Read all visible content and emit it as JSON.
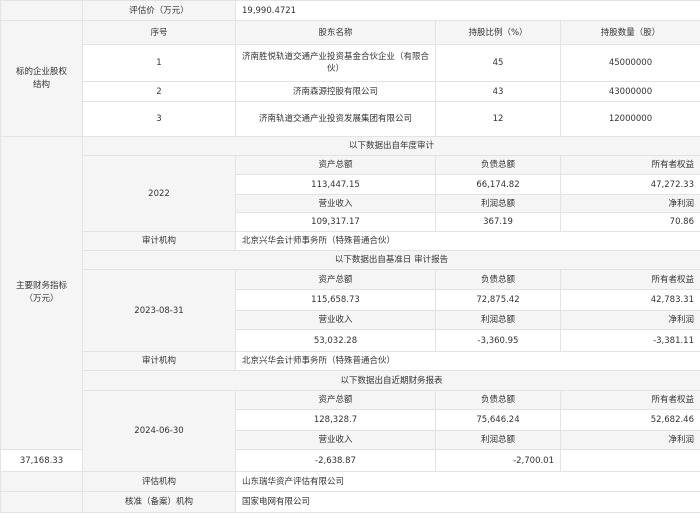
{
  "valuation": {
    "label": "评估价（万元）",
    "value": "19,990.4721"
  },
  "equity": {
    "section_label": "标的企业股权结构",
    "headers": [
      "序号",
      "股东名称",
      "持股比例（%）",
      "持股数量（股）"
    ],
    "rows": [
      {
        "no": "1",
        "name": "济南胜悦轨道交通产业投资基金合伙企业（有限合伙）",
        "ratio": "45",
        "shares": "45000000"
      },
      {
        "no": "2",
        "name": "济南森源控股有限公司",
        "ratio": "43",
        "shares": "43000000"
      },
      {
        "no": "3",
        "name": "济南轨道交通产业投资发展集团有限公司",
        "ratio": "12",
        "shares": "12000000"
      }
    ]
  },
  "financial": {
    "section_label": "主要财务指标（万元）",
    "periods": [
      {
        "source_note": "以下数据出自年度审计",
        "period": "2022",
        "h1": [
          "资产总额",
          "负债总额",
          "所有者权益"
        ],
        "v1": [
          "113,447.15",
          "66,174.82",
          "47,272.33"
        ],
        "h2": [
          "营业收入",
          "利润总额",
          "净利润"
        ],
        "v2": [
          "109,317.17",
          "367.19",
          "70.86"
        ],
        "auditor_label": "审计机构",
        "auditor": "北京兴华会计师事务所（特殊普通合伙）"
      },
      {
        "source_note": "以下数据出自基准日 审计报告",
        "period": "2023-08-31",
        "h1": [
          "资产总额",
          "负债总额",
          "所有者权益"
        ],
        "v1": [
          "115,658.73",
          "72,875.42",
          "42,783.31"
        ],
        "h2": [
          "营业收入",
          "利润总额",
          "净利润"
        ],
        "v2": [
          "53,032.28",
          "-3,360.95",
          "-3,381.11"
        ],
        "auditor_label": "审计机构",
        "auditor": "北京兴华会计师事务所（特殊普通合伙）"
      },
      {
        "source_note": "以下数据出自近期财务报表",
        "period": "2024-06-30",
        "h1": [
          "资产总额",
          "负债总额",
          "所有者权益"
        ],
        "v1": [
          "128,328.7",
          "75,646.24",
          "52,682.46"
        ],
        "h2": [
          "营业收入",
          "利润总额",
          "净利润"
        ],
        "v2": [
          "37,168.33",
          "-2,638.87",
          "-2,700.01"
        ]
      }
    ]
  },
  "appraiser": {
    "label": "评估机构",
    "value": "山东瑞华资产评估有限公司"
  },
  "approver": {
    "label": "核准（备案）机构",
    "value": "国家电网有限公司"
  }
}
